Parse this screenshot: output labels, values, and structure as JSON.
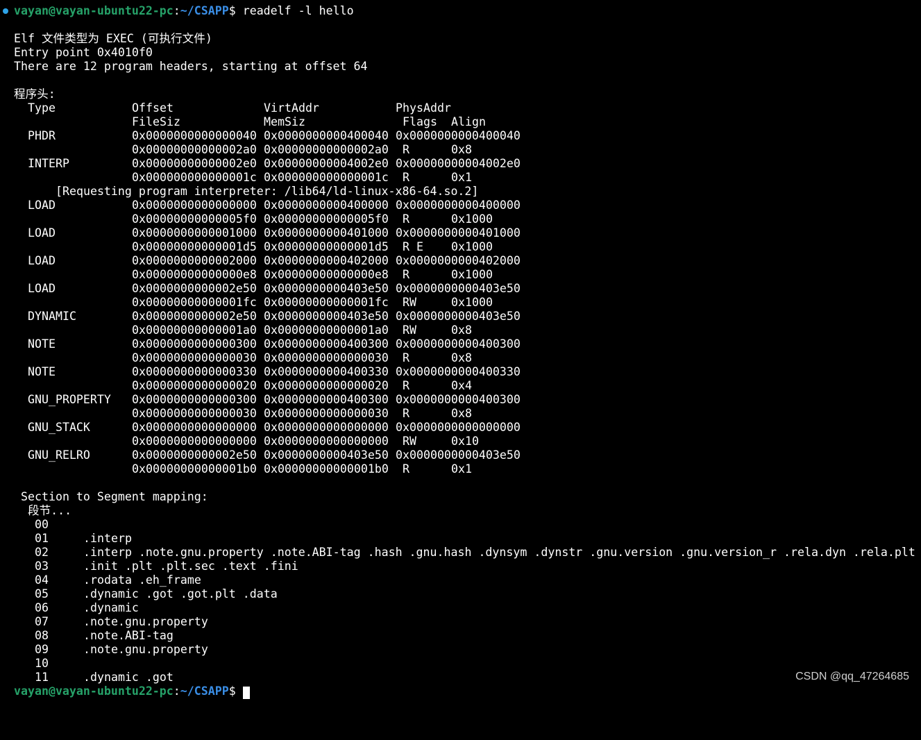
{
  "prompt": {
    "user": "vayan@vayan-ubuntu22-pc",
    "path": "~/CSAPP",
    "dollar": "$",
    "command": " readelf -l hello"
  },
  "header_lines": [
    "Elf 文件类型为 EXEC (可执行文件)",
    "Entry point 0x4010f0",
    "There are 12 program headers, starting at offset 64"
  ],
  "program_headers_title": "程序头:",
  "columns": {
    "type": "Type",
    "offset": "Offset",
    "virt": "VirtAddr",
    "phys": "PhysAddr",
    "filesiz": "FileSiz",
    "memsiz": "MemSiz",
    "flags": "Flags",
    "align": "Align"
  },
  "headers": [
    {
      "type": "PHDR",
      "offset": "0x0000000000000040",
      "virt": "0x0000000000400040",
      "phys": "0x0000000000400040",
      "filesiz": "0x00000000000002a0",
      "memsiz": "0x00000000000002a0",
      "flags": "R",
      "align": "0x8"
    },
    {
      "type": "INTERP",
      "offset": "0x00000000000002e0",
      "virt": "0x00000000004002e0",
      "phys": "0x00000000004002e0",
      "filesiz": "0x000000000000001c",
      "memsiz": "0x000000000000001c",
      "flags": "R",
      "align": "0x1"
    },
    {
      "type": "LOAD",
      "offset": "0x0000000000000000",
      "virt": "0x0000000000400000",
      "phys": "0x0000000000400000",
      "filesiz": "0x00000000000005f0",
      "memsiz": "0x00000000000005f0",
      "flags": "R",
      "align": "0x1000"
    },
    {
      "type": "LOAD",
      "offset": "0x0000000000001000",
      "virt": "0x0000000000401000",
      "phys": "0x0000000000401000",
      "filesiz": "0x00000000000001d5",
      "memsiz": "0x00000000000001d5",
      "flags": "R E",
      "align": "0x1000"
    },
    {
      "type": "LOAD",
      "offset": "0x0000000000002000",
      "virt": "0x0000000000402000",
      "phys": "0x0000000000402000",
      "filesiz": "0x00000000000000e8",
      "memsiz": "0x00000000000000e8",
      "flags": "R",
      "align": "0x1000"
    },
    {
      "type": "LOAD",
      "offset": "0x0000000000002e50",
      "virt": "0x0000000000403e50",
      "phys": "0x0000000000403e50",
      "filesiz": "0x00000000000001fc",
      "memsiz": "0x00000000000001fc",
      "flags": "RW",
      "align": "0x1000"
    },
    {
      "type": "DYNAMIC",
      "offset": "0x0000000000002e50",
      "virt": "0x0000000000403e50",
      "phys": "0x0000000000403e50",
      "filesiz": "0x00000000000001a0",
      "memsiz": "0x00000000000001a0",
      "flags": "RW",
      "align": "0x8"
    },
    {
      "type": "NOTE",
      "offset": "0x0000000000000300",
      "virt": "0x0000000000400300",
      "phys": "0x0000000000400300",
      "filesiz": "0x0000000000000030",
      "memsiz": "0x0000000000000030",
      "flags": "R",
      "align": "0x8"
    },
    {
      "type": "NOTE",
      "offset": "0x0000000000000330",
      "virt": "0x0000000000400330",
      "phys": "0x0000000000400330",
      "filesiz": "0x0000000000000020",
      "memsiz": "0x0000000000000020",
      "flags": "R",
      "align": "0x4"
    },
    {
      "type": "GNU_PROPERTY",
      "offset": "0x0000000000000300",
      "virt": "0x0000000000400300",
      "phys": "0x0000000000400300",
      "filesiz": "0x0000000000000030",
      "memsiz": "0x0000000000000030",
      "flags": "R",
      "align": "0x8"
    },
    {
      "type": "GNU_STACK",
      "offset": "0x0000000000000000",
      "virt": "0x0000000000000000",
      "phys": "0x0000000000000000",
      "filesiz": "0x0000000000000000",
      "memsiz": "0x0000000000000000",
      "flags": "RW",
      "align": "0x10"
    },
    {
      "type": "GNU_RELRO",
      "offset": "0x0000000000002e50",
      "virt": "0x0000000000403e50",
      "phys": "0x0000000000403e50",
      "filesiz": "0x00000000000001b0",
      "memsiz": "0x00000000000001b0",
      "flags": "R",
      "align": "0x1"
    }
  ],
  "interp_note": "[Requesting program interpreter: /lib64/ld-linux-x86-64.so.2]",
  "mapping_title": "Section to Segment mapping:",
  "mapping_sub": "段节...",
  "mapping": [
    {
      "seg": "00",
      "sections": ""
    },
    {
      "seg": "01",
      "sections": ".interp"
    },
    {
      "seg": "02",
      "sections": ".interp .note.gnu.property .note.ABI-tag .hash .gnu.hash .dynsym .dynstr .gnu.version .gnu.version_r .rela.dyn .rela.plt"
    },
    {
      "seg": "03",
      "sections": ".init .plt .plt.sec .text .fini"
    },
    {
      "seg": "04",
      "sections": ".rodata .eh_frame"
    },
    {
      "seg": "05",
      "sections": ".dynamic .got .got.plt .data"
    },
    {
      "seg": "06",
      "sections": ".dynamic"
    },
    {
      "seg": "07",
      "sections": ".note.gnu.property"
    },
    {
      "seg": "08",
      "sections": ".note.ABI-tag"
    },
    {
      "seg": "09",
      "sections": ".note.gnu.property"
    },
    {
      "seg": "10",
      "sections": ""
    },
    {
      "seg": "11",
      "sections": ".dynamic .got"
    }
  ],
  "next_prompt": {
    "user": "vayan@vayan-ubuntu22-pc",
    "path": "~/CSAPP",
    "dollar": "$"
  },
  "watermark": "CSDN @qq_47264685",
  "colors": {
    "background": "#000000",
    "text": "#ffffff",
    "user": "#26a269",
    "path": "#3a8ee6",
    "marker": "#2ea3e8"
  }
}
